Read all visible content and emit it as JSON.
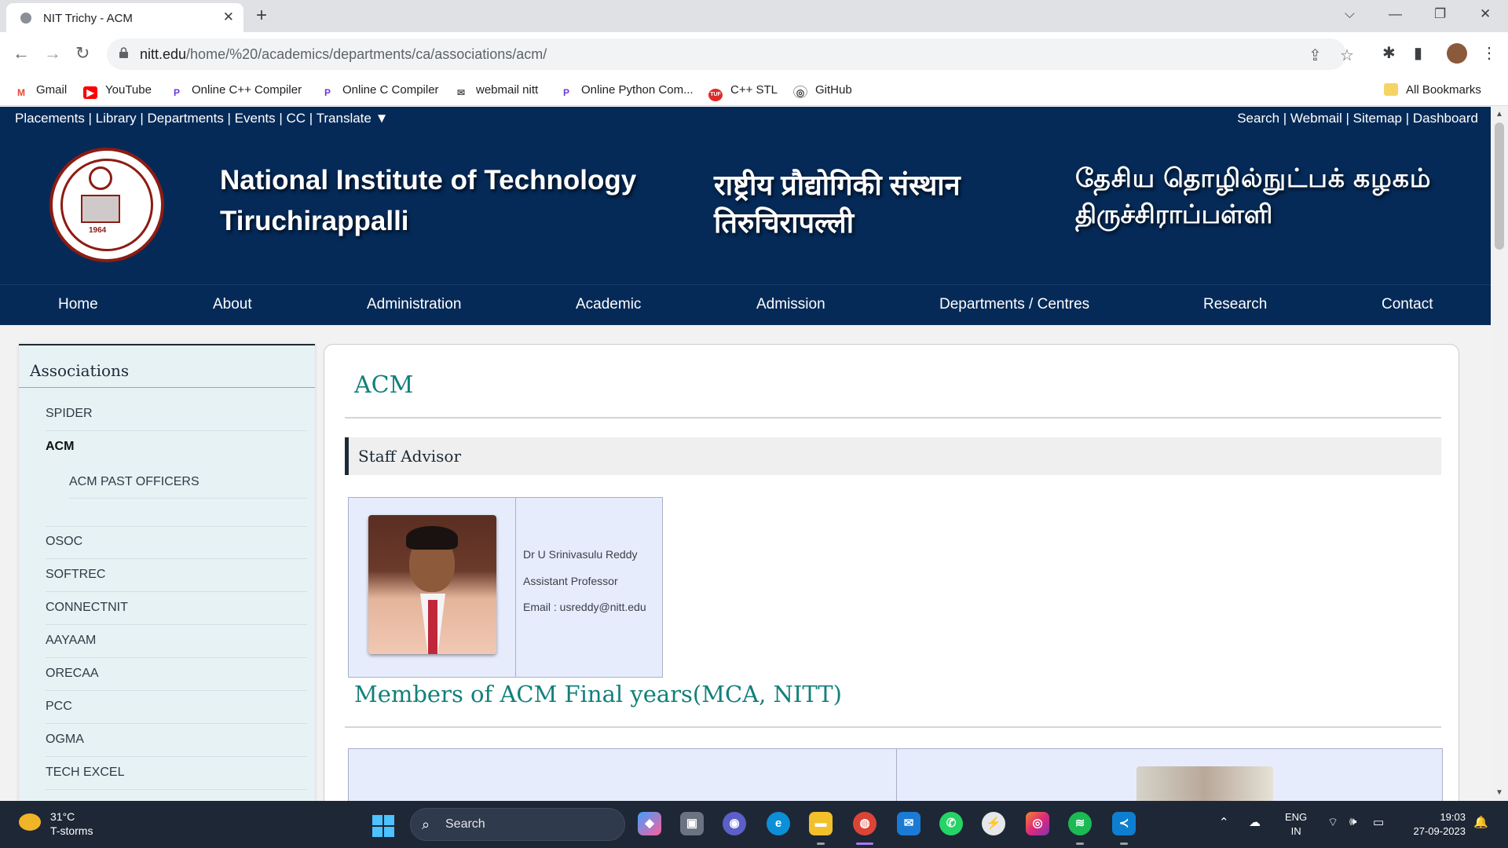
{
  "browser": {
    "tab_title": "NIT Trichy - ACM",
    "url_domain": "nitt.edu",
    "url_path": "/home/%20/academics/departments/ca/associations/acm/",
    "bookmarks": [
      "Gmail",
      "YouTube",
      "Online C++ Compiler",
      "Online C Compiler",
      "webmail nitt",
      "Online Python Com...",
      "C++ STL",
      "GitHub"
    ],
    "all_bookmarks": "All Bookmarks"
  },
  "site": {
    "util_left": "Placements | Library | Departments | Events | CC | Translate ▼",
    "util_right": "Search | Webmail | Sitemap | Dashboard",
    "name_en_1": "National Institute of Technology",
    "name_en_2": "Tiruchirappalli",
    "name_hi_1": "राष्ट्रीय प्रौद्योगिकी संस्थान",
    "name_hi_2": "तिरुचिरापल्ली",
    "name_ta_1": "தேசிய தொழில்நுட்பக் கழகம்",
    "name_ta_2": "திருச்சிராப்பள்ளி",
    "seal_year": "1964",
    "nav": [
      "Home",
      "About",
      "Administration",
      "Academic",
      "Admission",
      "Departments / Centres",
      "Research",
      "Contact"
    ]
  },
  "sidebar": {
    "heading": "Associations",
    "items": [
      "SPIDER",
      "ACM",
      "ACM PAST OFFICERS",
      "OSOC",
      "SOFTREC",
      "CONNECTNIT",
      "AAYAAM",
      "ORECAA",
      "PCC",
      "OGMA",
      "TECH EXCEL"
    ],
    "active": "ACM"
  },
  "main": {
    "title": "ACM",
    "advisor_heading": "Staff Advisor",
    "advisor": {
      "name": "Dr U Srinivasulu Reddy",
      "designation": "Assistant Professor",
      "email": "Email : usreddy@nitt.edu"
    },
    "members_heading": "Members of ACM Final years(MCA, NITT)"
  },
  "taskbar": {
    "temp": "31°C",
    "weather": "T-storms",
    "search": "Search",
    "lang_1": "ENG",
    "lang_2": "IN",
    "time": "19:03",
    "date": "27-09-2023"
  }
}
